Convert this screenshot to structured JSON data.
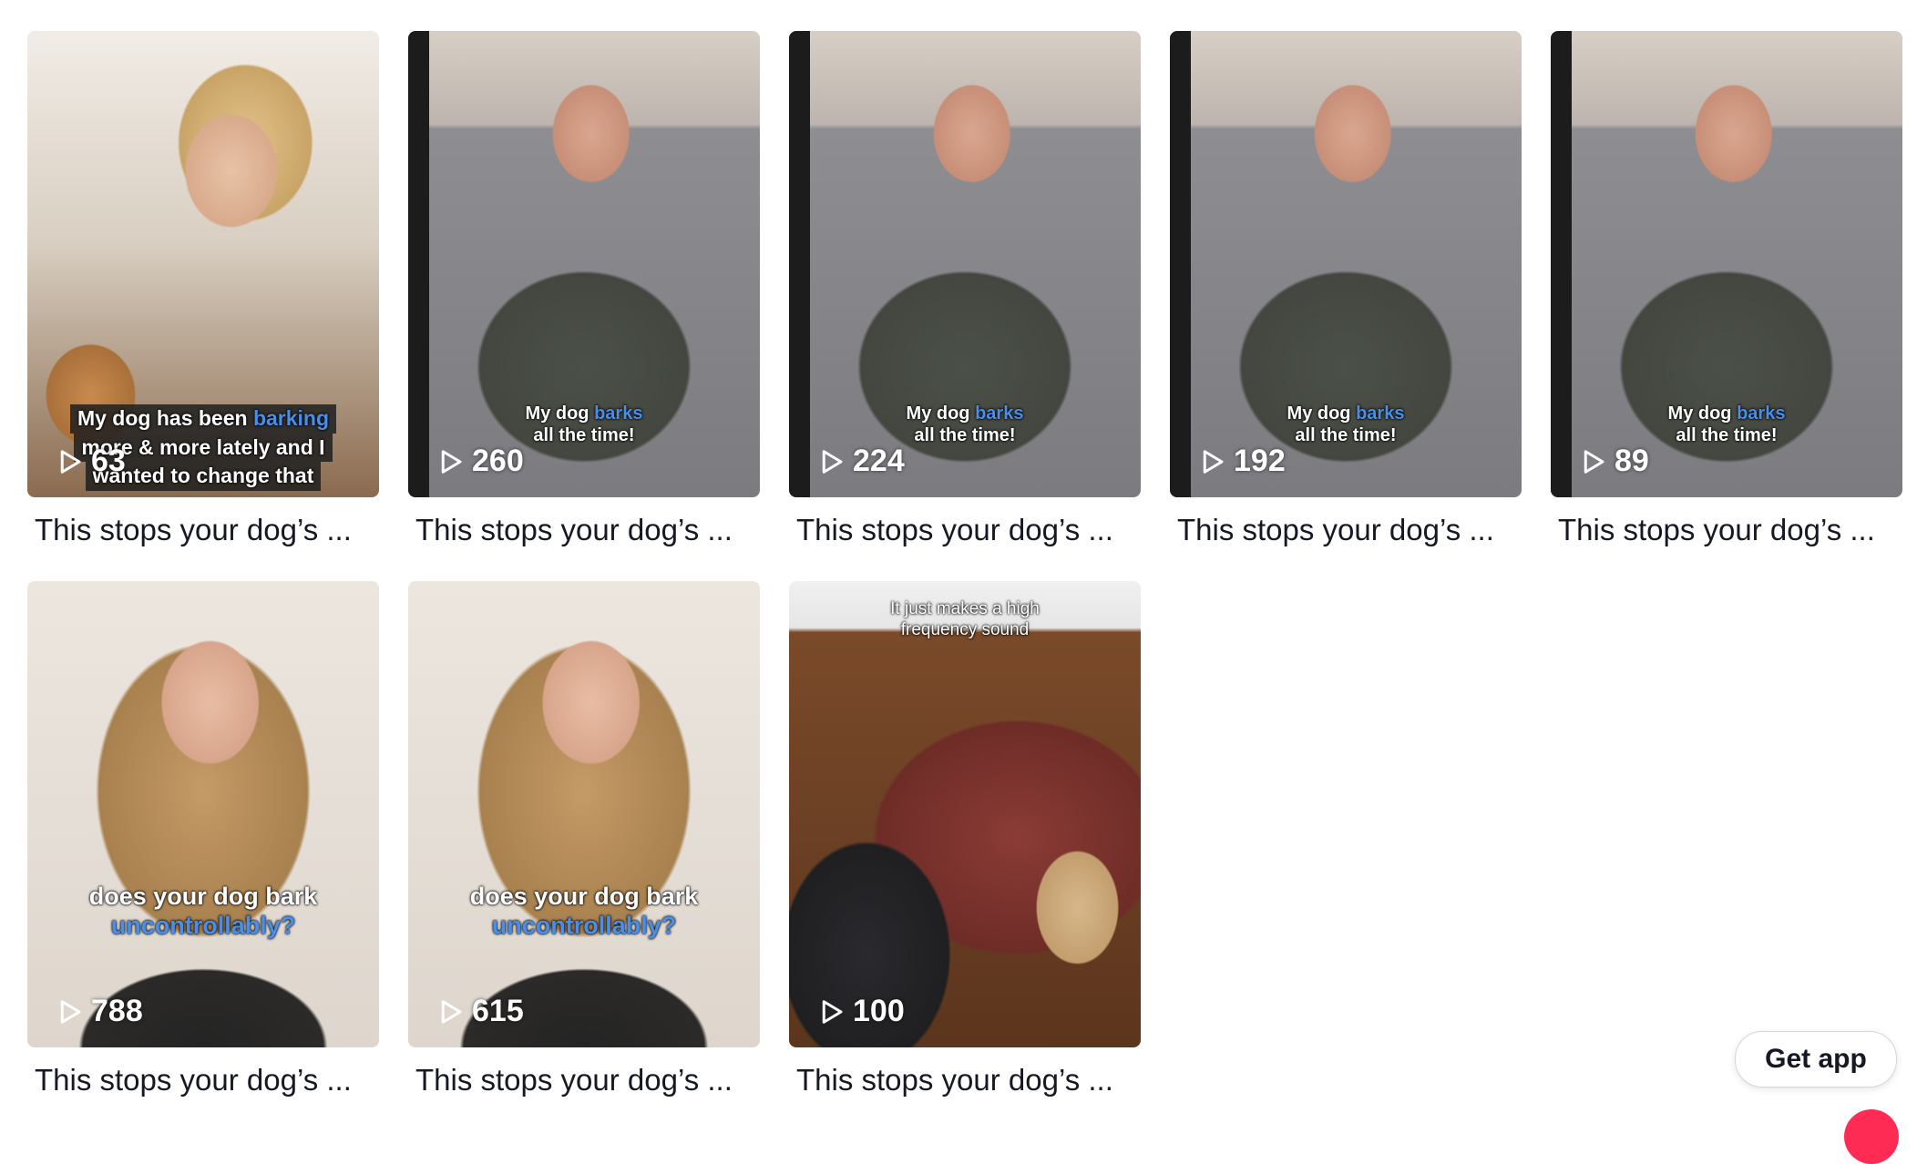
{
  "videos": [
    {
      "views": "63",
      "title": "This stops your dog’s ...",
      "caption_lines": [
        "My dog has been ",
        "barking",
        "more & more lately and I",
        "wanted to change that"
      ]
    },
    {
      "views": "260",
      "title": "This stops your dog’s ...",
      "caption_a": "My dog ",
      "caption_hl": "barks",
      "caption_b": "all the time!"
    },
    {
      "views": "224",
      "title": "This stops your dog’s ...",
      "caption_a": "My dog ",
      "caption_hl": "barks",
      "caption_b": "all the time!"
    },
    {
      "views": "192",
      "title": "This stops your dog’s ...",
      "caption_a": "My dog ",
      "caption_hl": "barks",
      "caption_b": "all the time!"
    },
    {
      "views": "89",
      "title": "This stops your dog’s ...",
      "caption_a": "My dog ",
      "caption_hl": "barks",
      "caption_b": "all the time!"
    },
    {
      "views": "788",
      "title": "This stops your dog’s ...",
      "caption_a": "does your dog bark",
      "caption_hl": "uncontrollably?"
    },
    {
      "views": "615",
      "title": "This stops your dog’s ...",
      "caption_a": "does your dog bark",
      "caption_hl": "uncontrollably?"
    },
    {
      "views": "100",
      "title": "This stops your dog’s ...",
      "caption_a": "It just makes a high",
      "caption_b": "frequency sound"
    }
  ],
  "get_app_label": "Get app",
  "icons": {
    "play": "play-icon"
  },
  "colors": {
    "caption_highlight": "#4a8ee8",
    "fab": "#fe2c55"
  }
}
